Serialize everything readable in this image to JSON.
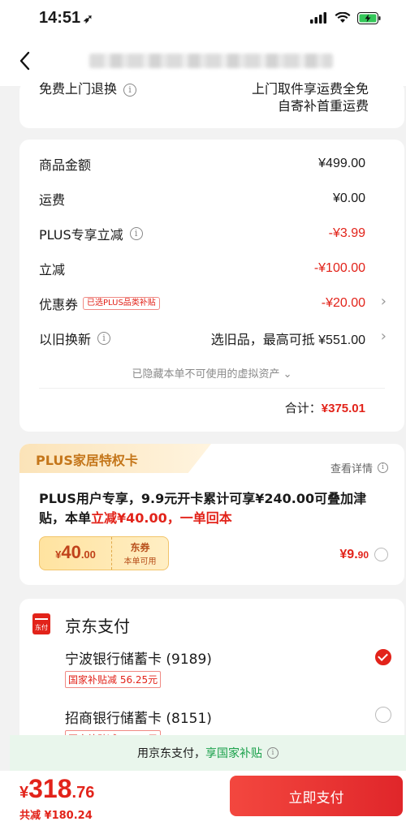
{
  "status_bar": {
    "time": "14:51"
  },
  "card1": {
    "left_label": "免费上门退换",
    "right_line1": "上门取件享运费全免",
    "right_line2": "自寄补首重运费"
  },
  "price_detail": {
    "rows": [
      {
        "label": "商品金额",
        "value": "¥499.00",
        "red": false
      },
      {
        "label": "运费",
        "value": "¥0.00",
        "red": false
      },
      {
        "label": "PLUS专享立减",
        "value": "-¥3.99",
        "red": true
      },
      {
        "label": "立减",
        "value": "-¥100.00",
        "red": true
      },
      {
        "label": "优惠券",
        "tag": "已选PLUS品类补贴",
        "value": "-¥20.00",
        "red": true
      },
      {
        "label": "以旧换新",
        "value": "选旧品，最高可抵 ¥551.00",
        "red": false
      }
    ],
    "hidden_note": "已隐藏本单不可使用的虚拟资产",
    "total_label": "合计：",
    "total_value": "¥375.01"
  },
  "plus_card": {
    "title": "PLUS家居特权卡",
    "detail_link": "查看详情",
    "desc_prefix": "PLUS用户专享，9.9元开卡累计可享¥240.00可叠加津贴，本单",
    "desc_highlight": "立减¥40.00，一单回本",
    "coupon_currency": "¥",
    "coupon_int": "40",
    "coupon_dec": ".00",
    "coupon_type": "东券",
    "coupon_note": "本单可用",
    "price_int": "¥9.",
    "price_dec": "90"
  },
  "payment": {
    "icon_text": "东付",
    "title": "京东支付",
    "banks": [
      {
        "name": "宁波银行储蓄卡 (9189)",
        "tag": "国家补贴减 56.25元",
        "selected": true
      },
      {
        "name": "招商银行储蓄卡 (8151)",
        "tag": "国家补贴减 56.25元",
        "selected": false
      }
    ]
  },
  "subsidy_bar": {
    "prefix": "用京东支付，",
    "highlight": "享国家补贴"
  },
  "bottom": {
    "currency": "¥",
    "amount_int": "318",
    "amount_dec": ".76",
    "saved": "共减 ¥180.24",
    "pay_button": "立即支付"
  },
  "colors": {
    "accent_red": "#e2231a",
    "plus_gold": "#c4761a",
    "subsidy_green": "#19a04a"
  }
}
